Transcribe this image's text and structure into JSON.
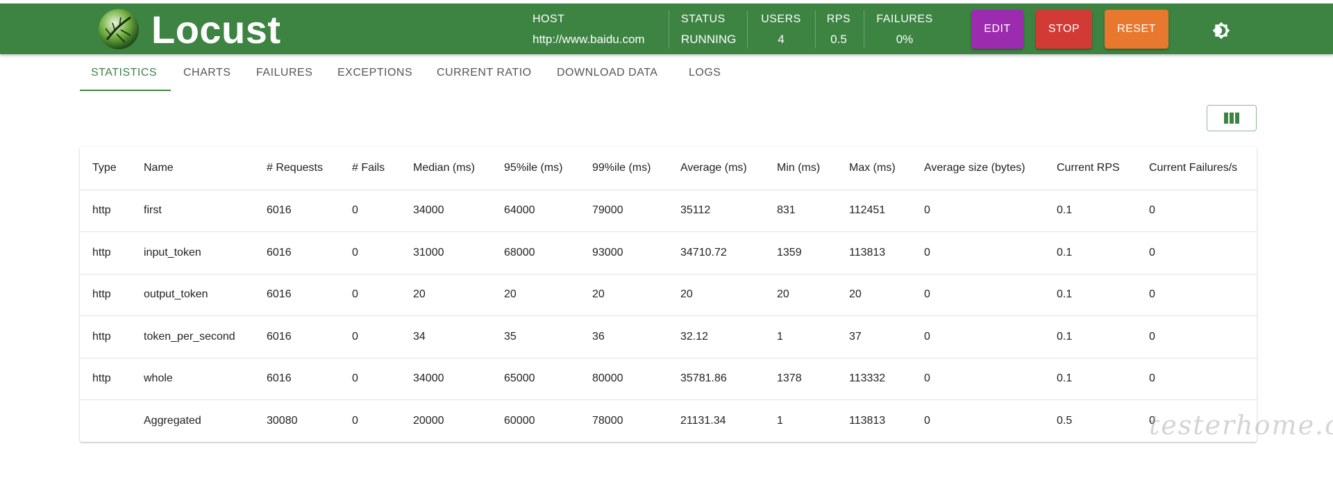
{
  "header": {
    "app_name": "Locust",
    "host_label": "HOST",
    "host_value": "http://www.baidu.com",
    "status_label": "STATUS",
    "status_value": "RUNNING",
    "users_label": "USERS",
    "users_value": "4",
    "rps_label": "RPS",
    "rps_value": "0.5",
    "failures_label": "FAILURES",
    "failures_value": "0%",
    "edit_label": "EDIT",
    "stop_label": "STOP",
    "reset_label": "RESET",
    "colors": {
      "bar": "#3d8443",
      "edit": "#9c2bb0",
      "stop": "#d23a36",
      "reset": "#e8782e"
    },
    "theme_icon": "brightness-icon"
  },
  "tabs": [
    {
      "label": "STATISTICS",
      "active": true
    },
    {
      "label": "CHARTS"
    },
    {
      "label": "FAILURES"
    },
    {
      "label": "EXCEPTIONS"
    },
    {
      "label": "CURRENT RATIO"
    },
    {
      "label": "DOWNLOAD DATA"
    },
    {
      "label": "LOGS"
    }
  ],
  "column_selector_icon": "view-column-icon",
  "table": {
    "headers": [
      "Type",
      "Name",
      "# Requests",
      "# Fails",
      "Median (ms)",
      "95%ile (ms)",
      "99%ile (ms)",
      "Average (ms)",
      "Min (ms)",
      "Max (ms)",
      "Average size (bytes)",
      "Current RPS",
      "Current Failures/s"
    ],
    "rows": [
      [
        "http",
        "first",
        "6016",
        "0",
        "34000",
        "64000",
        "79000",
        "35112",
        "831",
        "112451",
        "0",
        "0.1",
        "0"
      ],
      [
        "http",
        "input_token",
        "6016",
        "0",
        "31000",
        "68000",
        "93000",
        "34710.72",
        "1359",
        "113813",
        "0",
        "0.1",
        "0"
      ],
      [
        "http",
        "output_token",
        "6016",
        "0",
        "20",
        "20",
        "20",
        "20",
        "20",
        "20",
        "0",
        "0.1",
        "0"
      ],
      [
        "http",
        "token_per_second",
        "6016",
        "0",
        "34",
        "35",
        "36",
        "32.12",
        "1",
        "37",
        "0",
        "0.1",
        "0"
      ],
      [
        "http",
        "whole",
        "6016",
        "0",
        "34000",
        "65000",
        "80000",
        "35781.86",
        "1378",
        "113332",
        "0",
        "0.1",
        "0"
      ],
      [
        "",
        "Aggregated",
        "30080",
        "0",
        "20000",
        "60000",
        "78000",
        "21131.34",
        "1",
        "113813",
        "0",
        "0.5",
        "0"
      ]
    ]
  },
  "watermark": "testerhome.com"
}
